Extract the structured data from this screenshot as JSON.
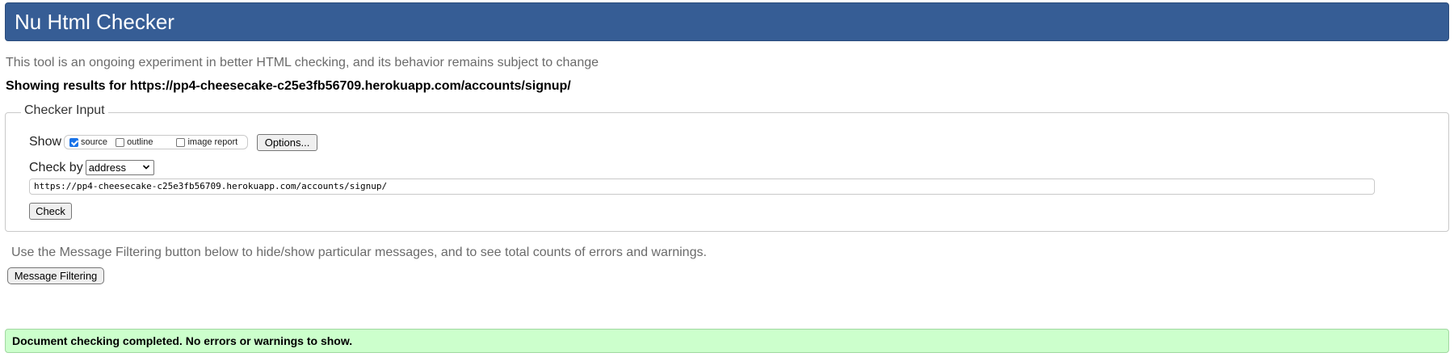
{
  "header": {
    "title": "Nu Html Checker"
  },
  "intro_text": "This tool is an ongoing experiment in better HTML checking, and its behavior remains subject to change",
  "results_for": "Showing results for https://pp4-cheesecake-c25e3fb56709.herokuapp.com/accounts/signup/",
  "checker_input": {
    "legend": "Checker Input",
    "show_label": "Show",
    "show_options": [
      {
        "label": "source",
        "checked": true
      },
      {
        "label": "outline",
        "checked": false
      },
      {
        "label": "image report",
        "checked": false
      }
    ],
    "options_button": "Options...",
    "check_by_label": "Check by",
    "check_by_selected": "address",
    "url_value": "https://pp4-cheesecake-c25e3fb56709.herokuapp.com/accounts/signup/",
    "check_button": "Check"
  },
  "filter": {
    "note": "Use the Message Filtering button below to hide/show particular messages, and to see total counts of errors and warnings.",
    "button": "Message Filtering"
  },
  "status": {
    "message": "Document checking completed. No errors or warnings to show.",
    "color": "#ccffcc"
  },
  "colors": {
    "header_bg": "#365d95",
    "header_text": "#ffffff",
    "muted_text": "#6b6b6b"
  }
}
